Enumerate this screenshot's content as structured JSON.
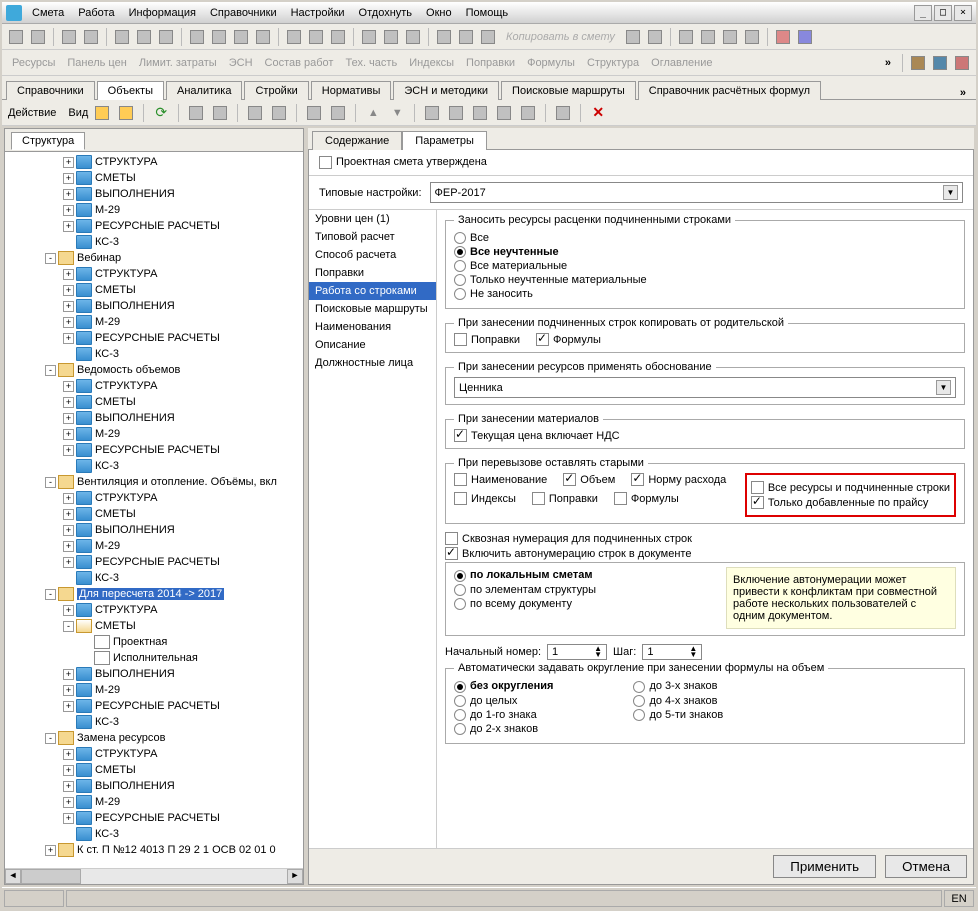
{
  "menu": {
    "items": [
      "Смета",
      "Работа",
      "Информация",
      "Справочники",
      "Настройки",
      "Отдохнуть",
      "Окно",
      "Помощь"
    ]
  },
  "toolbar2": {
    "items": [
      "Ресурсы",
      "Панель цен",
      "Лимит. затраты",
      "ЭСН",
      "Состав работ",
      "Тех. часть",
      "Индексы",
      "Поправки",
      "Формулы",
      "Структура",
      "Оглавление"
    ]
  },
  "copy_label": "Копировать в смету",
  "main_tabs": [
    "Справочники",
    "Объекты",
    "Аналитика",
    "Стройки",
    "Нормативы",
    "ЭСН и методики",
    "Поисковые маршруты",
    "Справочник расчётных формул"
  ],
  "main_tabs_active": 1,
  "action_bar": {
    "action": "Действие",
    "view": "Вид"
  },
  "left_tab": "Структура",
  "tree": [
    {
      "d": 2,
      "t": "fold-blue",
      "e": "+",
      "l": "СТРУКТУРА"
    },
    {
      "d": 2,
      "t": "fold-blue",
      "e": "+",
      "l": "СМЕТЫ"
    },
    {
      "d": 2,
      "t": "fold-blue",
      "e": "+",
      "l": "ВЫПОЛНЕНИЯ"
    },
    {
      "d": 2,
      "t": "fold-blue",
      "e": "+",
      "l": "М-29"
    },
    {
      "d": 2,
      "t": "fold-blue",
      "e": "+",
      "l": "РЕСУРСНЫЕ РАСЧЕТЫ"
    },
    {
      "d": 2,
      "t": "fold-blue",
      "e": null,
      "l": "КС-3"
    },
    {
      "d": 1,
      "t": "fold-home",
      "e": "-",
      "l": "Вебинар"
    },
    {
      "d": 2,
      "t": "fold-blue",
      "e": "+",
      "l": "СТРУКТУРА"
    },
    {
      "d": 2,
      "t": "fold-blue",
      "e": "+",
      "l": "СМЕТЫ"
    },
    {
      "d": 2,
      "t": "fold-blue",
      "e": "+",
      "l": "ВЫПОЛНЕНИЯ"
    },
    {
      "d": 2,
      "t": "fold-blue",
      "e": "+",
      "l": "М-29"
    },
    {
      "d": 2,
      "t": "fold-blue",
      "e": "+",
      "l": "РЕСУРСНЫЕ РАСЧЕТЫ"
    },
    {
      "d": 2,
      "t": "fold-blue",
      "e": null,
      "l": "КС-3"
    },
    {
      "d": 1,
      "t": "fold-home",
      "e": "-",
      "l": "Ведомость объемов"
    },
    {
      "d": 2,
      "t": "fold-blue",
      "e": "+",
      "l": "СТРУКТУРА"
    },
    {
      "d": 2,
      "t": "fold-blue",
      "e": "+",
      "l": "СМЕТЫ"
    },
    {
      "d": 2,
      "t": "fold-blue",
      "e": "+",
      "l": "ВЫПОЛНЕНИЯ"
    },
    {
      "d": 2,
      "t": "fold-blue",
      "e": "+",
      "l": "М-29"
    },
    {
      "d": 2,
      "t": "fold-blue",
      "e": "+",
      "l": "РЕСУРСНЫЕ РАСЧЕТЫ"
    },
    {
      "d": 2,
      "t": "fold-blue",
      "e": null,
      "l": "КС-3"
    },
    {
      "d": 1,
      "t": "fold-home",
      "e": "-",
      "l": "Вентиляция и отопление. Объёмы, вкл"
    },
    {
      "d": 2,
      "t": "fold-blue",
      "e": "+",
      "l": "СТРУКТУРА"
    },
    {
      "d": 2,
      "t": "fold-blue",
      "e": "+",
      "l": "СМЕТЫ"
    },
    {
      "d": 2,
      "t": "fold-blue",
      "e": "+",
      "l": "ВЫПОЛНЕНИЯ"
    },
    {
      "d": 2,
      "t": "fold-blue",
      "e": "+",
      "l": "М-29"
    },
    {
      "d": 2,
      "t": "fold-blue",
      "e": "+",
      "l": "РЕСУРСНЫЕ РАСЧЕТЫ"
    },
    {
      "d": 2,
      "t": "fold-blue",
      "e": null,
      "l": "КС-3"
    },
    {
      "d": 1,
      "t": "fold-home",
      "e": "-",
      "l": "Для пересчета 2014 -> 2017",
      "sel": true
    },
    {
      "d": 2,
      "t": "fold-blue",
      "e": "+",
      "l": "СТРУКТУРА"
    },
    {
      "d": 2,
      "t": "fold-open",
      "e": "-",
      "l": "СМЕТЫ"
    },
    {
      "d": 3,
      "t": "fold-doc",
      "e": null,
      "l": "Проектная"
    },
    {
      "d": 3,
      "t": "fold-doc",
      "e": null,
      "l": "Исполнительная"
    },
    {
      "d": 2,
      "t": "fold-blue",
      "e": "+",
      "l": "ВЫПОЛНЕНИЯ"
    },
    {
      "d": 2,
      "t": "fold-blue",
      "e": "+",
      "l": "М-29"
    },
    {
      "d": 2,
      "t": "fold-blue",
      "e": "+",
      "l": "РЕСУРСНЫЕ РАСЧЕТЫ"
    },
    {
      "d": 2,
      "t": "fold-blue",
      "e": null,
      "l": "КС-3"
    },
    {
      "d": 1,
      "t": "fold-home",
      "e": "-",
      "l": "Замена ресурсов"
    },
    {
      "d": 2,
      "t": "fold-blue",
      "e": "+",
      "l": "СТРУКТУРА"
    },
    {
      "d": 2,
      "t": "fold-blue",
      "e": "+",
      "l": "СМЕТЫ"
    },
    {
      "d": 2,
      "t": "fold-blue",
      "e": "+",
      "l": "ВЫПОЛНЕНИЯ"
    },
    {
      "d": 2,
      "t": "fold-blue",
      "e": "+",
      "l": "М-29"
    },
    {
      "d": 2,
      "t": "fold-blue",
      "e": "+",
      "l": "РЕСУРСНЫЕ РАСЧЕТЫ"
    },
    {
      "d": 2,
      "t": "fold-blue",
      "e": null,
      "l": "КС-3"
    },
    {
      "d": 1,
      "t": "fold-home",
      "e": "+",
      "l": "К ст. П №12 4013 П 29 2 1 ОСВ 02 01 0"
    }
  ],
  "rp_tabs": [
    "Содержание",
    "Параметры"
  ],
  "rp_active": 1,
  "approved": "Проектная смета утверждена",
  "typical_label": "Типовые настройки:",
  "typical_value": "ФЕР-2017",
  "param_list": [
    "Уровни цен (1)",
    "Типовой расчет",
    "Способ расчета",
    "Поправки",
    "Работа со строками",
    "Поисковые маршруты",
    "Наименования",
    "Описание",
    "Должностные лица"
  ],
  "param_sel": 4,
  "g1": {
    "legend": "Заносить ресурсы расценки подчиненными строками",
    "opts": [
      "Все",
      "Все неучтенные",
      "Все материальные",
      "Только неучтенные материальные",
      "Не заносить"
    ],
    "sel": 1
  },
  "g2": {
    "legend": "При занесении подчиненных строк копировать от родительской",
    "c1": "Поправки",
    "c2": "Формулы"
  },
  "g3": {
    "legend": "При занесении ресурсов применять обоснование",
    "value": "Ценника"
  },
  "g4": {
    "legend": "При занесении материалов",
    "c1": "Текущая цена включает НДС"
  },
  "g5": {
    "legend": "При перевызове оставлять старыми",
    "c": [
      "Наименование",
      "Объем",
      "Норму расхода",
      "Все ресурсы и подчиненные строки",
      "Индексы",
      "Поправки",
      "Формулы",
      "Только добавленные по прайсу"
    ],
    "on": [
      false,
      true,
      true,
      false,
      false,
      false,
      false,
      true
    ]
  },
  "through_num": "Сквозная нумерация для подчиненных строк",
  "autonum": "Включить автонумерацию строк в документе",
  "autonum_note": "Включение автонумерации может привести к конфликтам при совместной работе нескольких пользователей с одним документом.",
  "autonum_opts": [
    "по локальным сметам",
    "по элементам структуры",
    "по всему документу"
  ],
  "autonum_sel": 0,
  "startnum_label": "Начальный номер:",
  "startnum": "1",
  "step_label": "Шаг:",
  "step": "1",
  "g6": {
    "legend": "Автоматически задавать округление при занесении формулы на объем",
    "left": [
      "без округления",
      "до целых",
      "до 1-го знака",
      "до 2-х знаков"
    ],
    "right": [
      "до 3-х знаков",
      "до 4-х знаков",
      "до 5-ти знаков"
    ],
    "sel": 0
  },
  "btn_apply": "Применить",
  "btn_cancel": "Отмена",
  "status_lang": "EN"
}
